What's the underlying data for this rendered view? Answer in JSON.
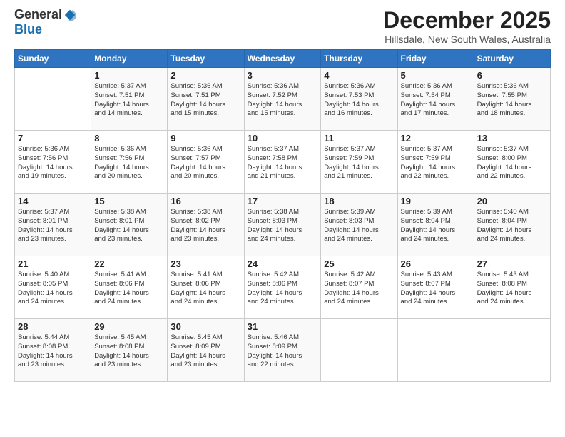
{
  "logo": {
    "general": "General",
    "blue": "Blue"
  },
  "header": {
    "title": "December 2025",
    "location": "Hillsdale, New South Wales, Australia"
  },
  "weekdays": [
    "Sunday",
    "Monday",
    "Tuesday",
    "Wednesday",
    "Thursday",
    "Friday",
    "Saturday"
  ],
  "weeks": [
    [
      {
        "day": "",
        "info": ""
      },
      {
        "day": "1",
        "info": "Sunrise: 5:37 AM\nSunset: 7:51 PM\nDaylight: 14 hours\nand 14 minutes."
      },
      {
        "day": "2",
        "info": "Sunrise: 5:36 AM\nSunset: 7:51 PM\nDaylight: 14 hours\nand 15 minutes."
      },
      {
        "day": "3",
        "info": "Sunrise: 5:36 AM\nSunset: 7:52 PM\nDaylight: 14 hours\nand 15 minutes."
      },
      {
        "day": "4",
        "info": "Sunrise: 5:36 AM\nSunset: 7:53 PM\nDaylight: 14 hours\nand 16 minutes."
      },
      {
        "day": "5",
        "info": "Sunrise: 5:36 AM\nSunset: 7:54 PM\nDaylight: 14 hours\nand 17 minutes."
      },
      {
        "day": "6",
        "info": "Sunrise: 5:36 AM\nSunset: 7:55 PM\nDaylight: 14 hours\nand 18 minutes."
      }
    ],
    [
      {
        "day": "7",
        "info": "Sunrise: 5:36 AM\nSunset: 7:56 PM\nDaylight: 14 hours\nand 19 minutes."
      },
      {
        "day": "8",
        "info": "Sunrise: 5:36 AM\nSunset: 7:56 PM\nDaylight: 14 hours\nand 20 minutes."
      },
      {
        "day": "9",
        "info": "Sunrise: 5:36 AM\nSunset: 7:57 PM\nDaylight: 14 hours\nand 20 minutes."
      },
      {
        "day": "10",
        "info": "Sunrise: 5:37 AM\nSunset: 7:58 PM\nDaylight: 14 hours\nand 21 minutes."
      },
      {
        "day": "11",
        "info": "Sunrise: 5:37 AM\nSunset: 7:59 PM\nDaylight: 14 hours\nand 21 minutes."
      },
      {
        "day": "12",
        "info": "Sunrise: 5:37 AM\nSunset: 7:59 PM\nDaylight: 14 hours\nand 22 minutes."
      },
      {
        "day": "13",
        "info": "Sunrise: 5:37 AM\nSunset: 8:00 PM\nDaylight: 14 hours\nand 22 minutes."
      }
    ],
    [
      {
        "day": "14",
        "info": "Sunrise: 5:37 AM\nSunset: 8:01 PM\nDaylight: 14 hours\nand 23 minutes."
      },
      {
        "day": "15",
        "info": "Sunrise: 5:38 AM\nSunset: 8:01 PM\nDaylight: 14 hours\nand 23 minutes."
      },
      {
        "day": "16",
        "info": "Sunrise: 5:38 AM\nSunset: 8:02 PM\nDaylight: 14 hours\nand 23 minutes."
      },
      {
        "day": "17",
        "info": "Sunrise: 5:38 AM\nSunset: 8:03 PM\nDaylight: 14 hours\nand 24 minutes."
      },
      {
        "day": "18",
        "info": "Sunrise: 5:39 AM\nSunset: 8:03 PM\nDaylight: 14 hours\nand 24 minutes."
      },
      {
        "day": "19",
        "info": "Sunrise: 5:39 AM\nSunset: 8:04 PM\nDaylight: 14 hours\nand 24 minutes."
      },
      {
        "day": "20",
        "info": "Sunrise: 5:40 AM\nSunset: 8:04 PM\nDaylight: 14 hours\nand 24 minutes."
      }
    ],
    [
      {
        "day": "21",
        "info": "Sunrise: 5:40 AM\nSunset: 8:05 PM\nDaylight: 14 hours\nand 24 minutes."
      },
      {
        "day": "22",
        "info": "Sunrise: 5:41 AM\nSunset: 8:06 PM\nDaylight: 14 hours\nand 24 minutes."
      },
      {
        "day": "23",
        "info": "Sunrise: 5:41 AM\nSunset: 8:06 PM\nDaylight: 14 hours\nand 24 minutes."
      },
      {
        "day": "24",
        "info": "Sunrise: 5:42 AM\nSunset: 8:06 PM\nDaylight: 14 hours\nand 24 minutes."
      },
      {
        "day": "25",
        "info": "Sunrise: 5:42 AM\nSunset: 8:07 PM\nDaylight: 14 hours\nand 24 minutes."
      },
      {
        "day": "26",
        "info": "Sunrise: 5:43 AM\nSunset: 8:07 PM\nDaylight: 14 hours\nand 24 minutes."
      },
      {
        "day": "27",
        "info": "Sunrise: 5:43 AM\nSunset: 8:08 PM\nDaylight: 14 hours\nand 24 minutes."
      }
    ],
    [
      {
        "day": "28",
        "info": "Sunrise: 5:44 AM\nSunset: 8:08 PM\nDaylight: 14 hours\nand 23 minutes."
      },
      {
        "day": "29",
        "info": "Sunrise: 5:45 AM\nSunset: 8:08 PM\nDaylight: 14 hours\nand 23 minutes."
      },
      {
        "day": "30",
        "info": "Sunrise: 5:45 AM\nSunset: 8:09 PM\nDaylight: 14 hours\nand 23 minutes."
      },
      {
        "day": "31",
        "info": "Sunrise: 5:46 AM\nSunset: 8:09 PM\nDaylight: 14 hours\nand 22 minutes."
      },
      {
        "day": "",
        "info": ""
      },
      {
        "day": "",
        "info": ""
      },
      {
        "day": "",
        "info": ""
      }
    ]
  ]
}
